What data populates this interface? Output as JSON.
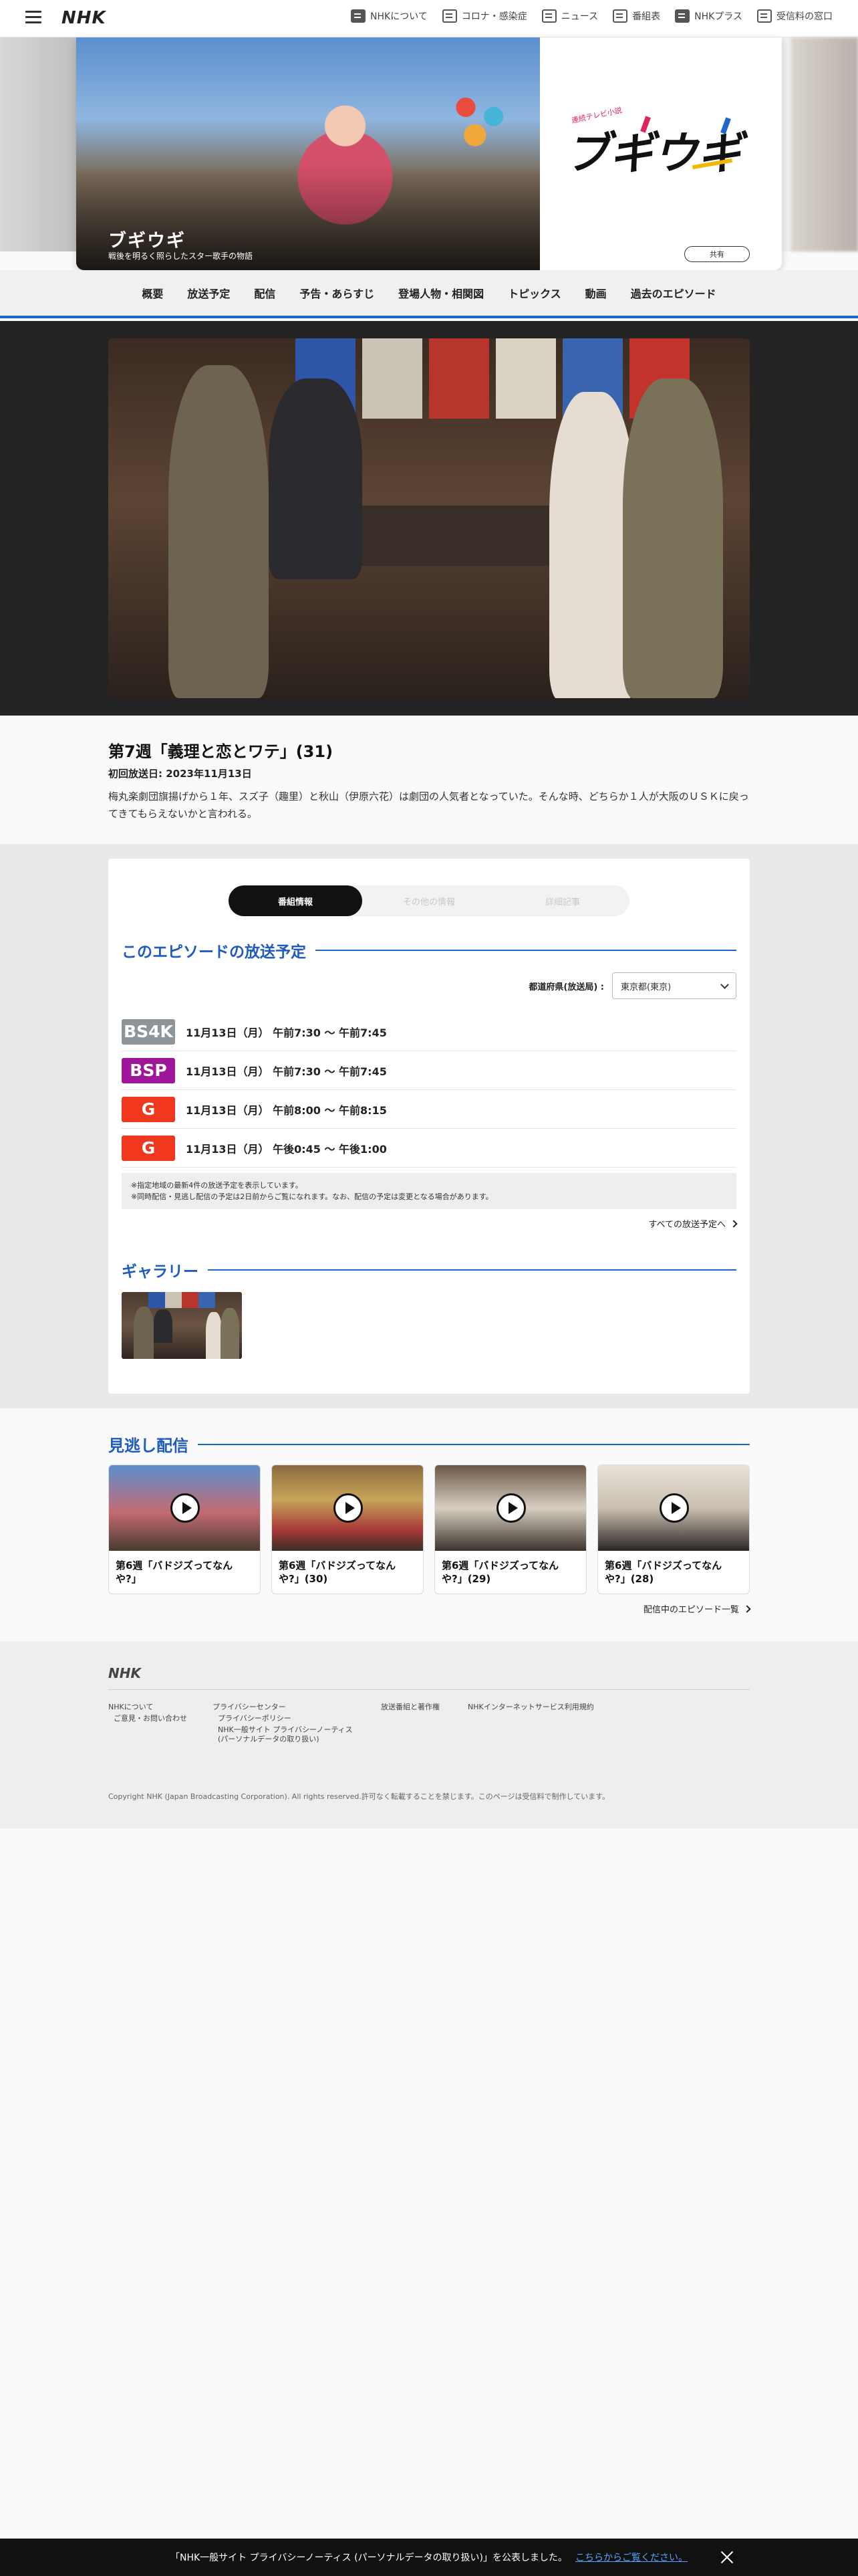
{
  "header": {
    "logo": "NHK",
    "links": [
      {
        "label": "NHKについて",
        "icon": "nhk-icon"
      },
      {
        "label": "コロナ・感染症",
        "icon": "document-icon"
      },
      {
        "label": "ニュース",
        "icon": "news-icon"
      },
      {
        "label": "番組表",
        "icon": "schedule-icon"
      },
      {
        "label": "NHKプラス",
        "icon": "nhkplus-icon"
      },
      {
        "label": "受信料の窓口",
        "icon": "receipt-icon"
      }
    ]
  },
  "hero": {
    "title": "ブギウギ",
    "subtitle": "戦後を明るく照らしたスター歌手の物語",
    "logo_text": "ブギウギ",
    "logo_small": "連続テレビ小説",
    "share_label": "共有"
  },
  "nav": {
    "items": [
      "概要",
      "放送予定",
      "配信",
      "予告・あらすじ",
      "登場人物・相関図",
      "トピックス",
      "動画",
      "過去のエピソード"
    ]
  },
  "episode": {
    "title": "第7週「義理と恋とワテ」(31)",
    "first_air": "初回放送日: 2023年11月13日",
    "description": "梅丸楽劇団旗揚げから１年、スズ子（趣里）と秋山（伊原六花）は劇団の人気者となっていた。そんな時、どちらか１人が大阪のＵＳＫに戻ってきてもらえないかと言われる。"
  },
  "tabs": [
    "番組情報",
    "その他の情報",
    "詳細記事"
  ],
  "schedule": {
    "heading": "このエピソードの放送予定",
    "pref_label": "都道府県(放送局) :",
    "pref_value": "東京都(東京)",
    "rows": [
      {
        "channel": "BS4K",
        "time": "11月13日（月） 午前7:30 〜 午前7:45",
        "color": "#8d959b"
      },
      {
        "channel": "BSP",
        "time": "11月13日（月） 午前7:30 〜 午前7:45",
        "color": "#a0169a"
      },
      {
        "channel": "G",
        "time": "11月13日（月） 午前8:00 〜 午前8:15",
        "color": "#f0381e"
      },
      {
        "channel": "G",
        "time": "11月13日（月） 午後0:45 〜 午後1:00",
        "color": "#f0381e"
      }
    ],
    "notes": [
      "※指定地域の最新4件の放送予定を表示しています。",
      "※同時配信・見逃し配信の予定は2日前からご覧になれます。なお、配信の予定は変更となる場合があります。"
    ],
    "more_label": "すべての放送予定へ"
  },
  "gallery": {
    "heading": "ギャラリー"
  },
  "missed": {
    "heading": "見逃し配信",
    "cards": [
      {
        "title": "第6週「バドジズってなんや?」"
      },
      {
        "title": "第6週「バドジズってなんや?」(30)"
      },
      {
        "title": "第6週「バドジズってなんや?」(29)"
      },
      {
        "title": "第6週「バドジズってなんや?」(28)"
      }
    ],
    "more_label": "配信中のエピソード一覧"
  },
  "footer": {
    "logo": "NHK",
    "links": {
      "about": "NHKについて",
      "contact": "ご意見・お問い合わせ",
      "privacy_center": "プライバシーセンター",
      "privacy_policy": "プライバシーポリシー",
      "privacy_notice_1": "NHK一般サイト プライバシーノーティス",
      "privacy_notice_2": "(パーソナルデータの取り扱い)",
      "copyright_link": "放送番組と著作権",
      "terms": "NHKインターネットサービス利用規約"
    },
    "copyright": "Copyright NHK (Japan Broadcasting Corporation). All rights reserved.許可なく転載することを禁じます。このページは受信料で制作しています。"
  },
  "cookie": {
    "text": "「NHK一般サイト プライバシーノーティス (パーソナルデータの取り扱い)」を公表しました。",
    "link": "こちらからご覧ください。"
  }
}
